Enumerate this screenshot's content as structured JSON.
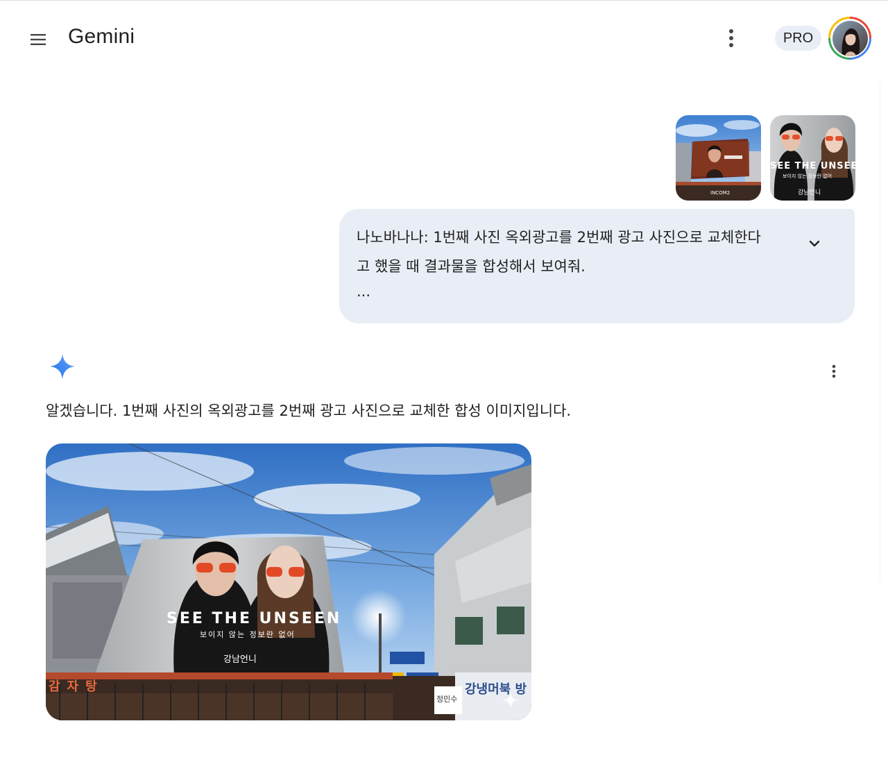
{
  "header": {
    "app_title": "Gemini",
    "pro_badge": "PRO",
    "icons": {
      "menu": "hamburger-menu-icon",
      "more": "more-vert-icon"
    }
  },
  "user_message": {
    "images": [
      {
        "name": "billboard-street-photo",
        "caption": "INCOM2"
      },
      {
        "name": "ad-poster-photo",
        "headline": "SEE THE UNSEE",
        "subline": "보이지 않는 정보란 없어",
        "brand": "강남언니"
      }
    ],
    "line1": "나노바나나: 1번째 사진 옥외광고를 2번째 광고 사진으로 교체한다",
    "line2": "고 했을 때 결과물을 합성해서 보여줘.",
    "ellipsis": "...",
    "expand_icon": "chevron-down-icon"
  },
  "model_response": {
    "text": "알겠습니다. 1번째 사진의 옥외광고를 2번째 광고 사진으로 교체한 합성 이미지입니다.",
    "more_icon": "more-vert-icon",
    "image": {
      "headline": "SEE THE UNSEEN",
      "subline": "보이지 않는 정보란 없어",
      "brand": "강남언니",
      "shop_sign_left": "감자탕",
      "shop_sign_right": "강냉머북 방",
      "street_sign": "정민수"
    }
  }
}
